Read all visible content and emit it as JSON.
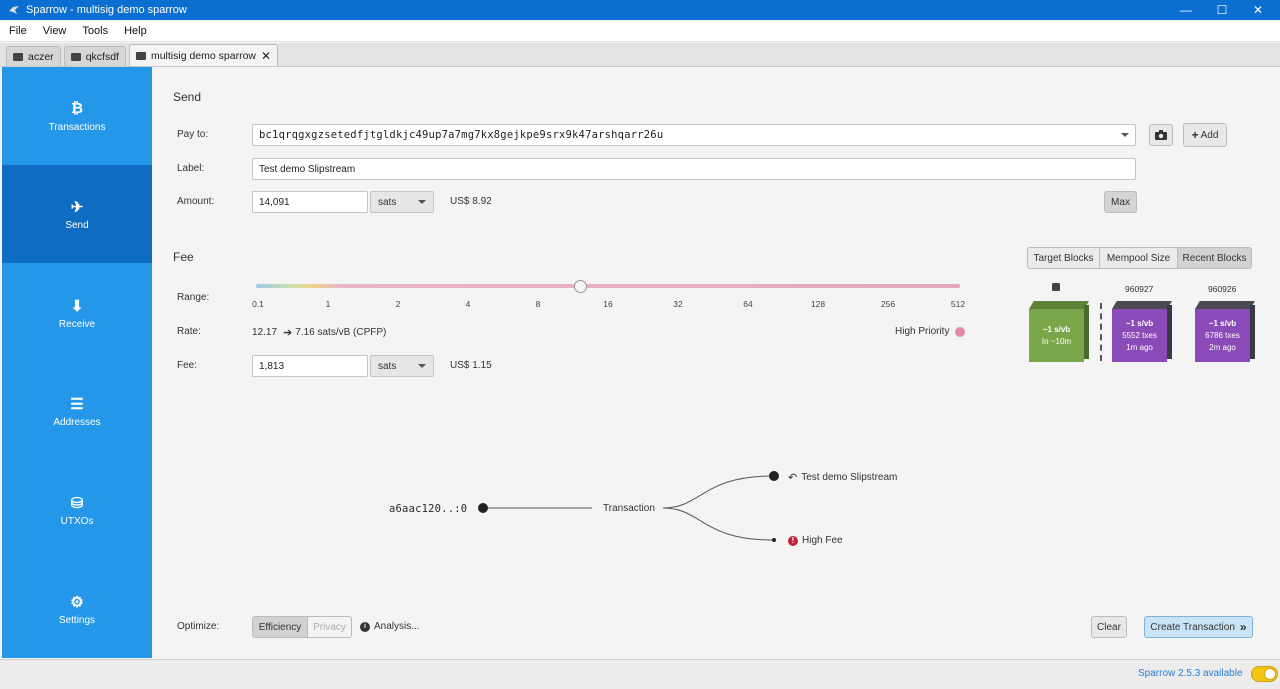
{
  "window": {
    "title": "Sparrow - multisig demo sparrow",
    "minimize": "—",
    "maximize": "☐",
    "close": "✕"
  },
  "menu": [
    "File",
    "View",
    "Tools",
    "Help"
  ],
  "tabs": [
    {
      "label": "aczer"
    },
    {
      "label": "qkcfsdf"
    },
    {
      "label": "multisig demo sparrow",
      "active": true,
      "close": "✕"
    }
  ],
  "sidebar": {
    "items": [
      {
        "label": "Transactions",
        "icon": "bitcoin-icon",
        "glyph": "₿"
      },
      {
        "label": "Send",
        "icon": "paper-plane-icon",
        "glyph": "✈",
        "active": true
      },
      {
        "label": "Receive",
        "icon": "arrow-down-icon",
        "glyph": "⬇"
      },
      {
        "label": "Addresses",
        "icon": "list-icon",
        "glyph": "☰"
      },
      {
        "label": "UTXOs",
        "icon": "coins-icon",
        "glyph": "⛁"
      },
      {
        "label": "Settings",
        "icon": "gear-icon",
        "glyph": "⚙"
      }
    ]
  },
  "send": {
    "heading": "Send",
    "pay_to_label": "Pay to:",
    "pay_to_value": "bc1qrqgxgzsetedfjtgldkjc49up7a7mg7kx8gejkpe9srx9k47arshqarr26u",
    "camera_icon": "camera-icon",
    "add_label": "Add",
    "add_glyph": "+",
    "label_label": "Label:",
    "label_value": "Test demo Slipstream",
    "amount_label": "Amount:",
    "amount_value": "14,091",
    "amount_unit": "sats",
    "amount_fiat": "US$ 8.92",
    "max_label": "Max"
  },
  "fee": {
    "heading": "Fee",
    "tabs": [
      {
        "label": "Target Blocks"
      },
      {
        "label": "Mempool Size"
      },
      {
        "label": "Recent Blocks",
        "selected": true
      }
    ],
    "range_label": "Range:",
    "range_ticks": [
      "0.1",
      "1",
      "2",
      "4",
      "8",
      "16",
      "32",
      "64",
      "128",
      "256",
      "512"
    ],
    "range_position": 0.46,
    "rate_label": "Rate:",
    "rate_value": "12.17",
    "rate_cpfp": "7.16 sats/vB (CPFP)",
    "priority_label": "High Priority",
    "priority_color": "#e08aa4",
    "fee_label": "Fee:",
    "fee_value": "1,813",
    "fee_unit": "sats",
    "fee_fiat": "US$ 1.15",
    "blocks": [
      {
        "number": "",
        "rate": "~1 s/vb",
        "txes": "",
        "eta": "In ~10m",
        "color": "#7aa64a"
      },
      {
        "number": "960927",
        "rate": "~1 s/vb",
        "txes": "5552 txes",
        "eta": "1m ago",
        "color": "#8a4bb8"
      },
      {
        "number": "960926",
        "rate": "~1 s/vb",
        "txes": "6786 txes",
        "eta": "2m ago",
        "color": "#8a4bb8"
      }
    ]
  },
  "diagram": {
    "input": "a6aac120..:0",
    "transaction": "Transaction",
    "output_label": "Test demo Slipstream",
    "fee_label": "High Fee"
  },
  "optimize": {
    "label": "Optimize:",
    "efficiency": "Efficiency",
    "privacy": "Privacy",
    "analysis": "Analysis..."
  },
  "actions": {
    "clear": "Clear",
    "create": "Create Transaction",
    "create_glyph": "»"
  },
  "status": {
    "update": "Sparrow 2.5.3 available"
  }
}
